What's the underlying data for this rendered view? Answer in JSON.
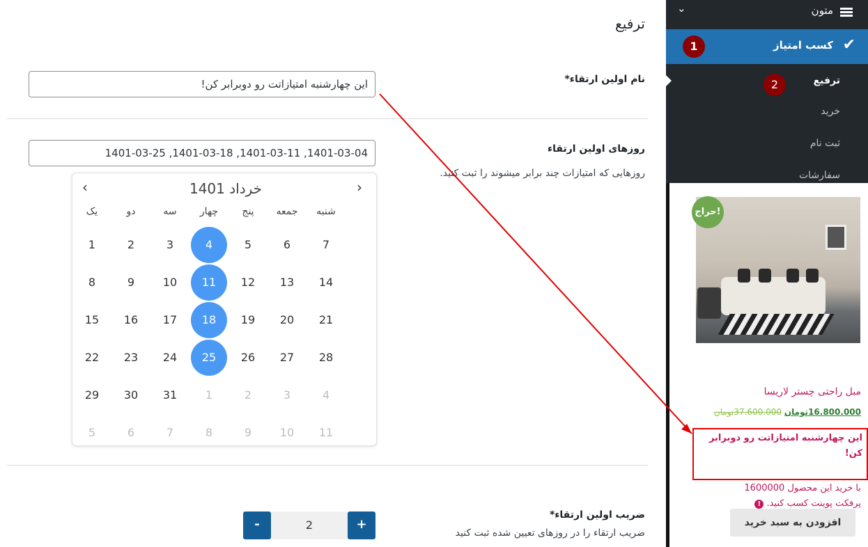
{
  "sidebar": {
    "menu_top": "متون",
    "active_item": "کسب امتیاز",
    "badge1": "1",
    "badge2": "2",
    "submenu": [
      "ترفیع",
      "خرید",
      "ثبت نام",
      "سفارشات"
    ]
  },
  "product": {
    "sale_badge": "حراج!",
    "title": "مبل راحتی چستر لاریسا",
    "price_old": "37.600.000",
    "price_old_currency": "تومان",
    "price_new": "16.800.000",
    "price_new_currency": "تومان",
    "promo_text": "این چهارشنبه امتیازاتت رو دوبرابر کن!",
    "points_line1": "با خرید این محصول 1600000",
    "points_line2": "پرفکت پوینت کسب کنید.",
    "add_to_cart": "افزودن به سبد خرید"
  },
  "form": {
    "page_title": "ترفیع",
    "name_label": "نام اولین ارتقاء*",
    "name_value": "این چهارشنبه امتیازاتت رو دوبرابر کن!",
    "days_label": "روزهای اولین ارتقاء",
    "days_value": "1401-03-04, 1401-03-11, 1401-03-18, 1401-03-25",
    "days_desc": "روزهایی که امتیازات چند برابر میشوند را ثبت کنید.",
    "multiplier_label": "ضریب اولین ارتقاء*",
    "multiplier_desc": "ضریب ارتقاء را در روزهای تعیین شده ثبت کنید",
    "multiplier_value": "2",
    "minus": "-",
    "plus": "+"
  },
  "calendar": {
    "title": "1401 خرداد",
    "prev": "‹",
    "next": "›",
    "weekdays": [
      "یک",
      "دو",
      "سه",
      "چهار",
      "پنج",
      "جمعه",
      "شنبه"
    ],
    "rows": [
      [
        "1",
        "2",
        "3",
        "4",
        "5",
        "6",
        "7"
      ],
      [
        "8",
        "9",
        "10",
        "11",
        "12",
        "13",
        "14"
      ],
      [
        "15",
        "16",
        "17",
        "18",
        "19",
        "20",
        "21"
      ],
      [
        "22",
        "23",
        "24",
        "25",
        "26",
        "27",
        "28"
      ],
      [
        "29",
        "30",
        "31",
        "1",
        "2",
        "3",
        "4"
      ],
      [
        "5",
        "6",
        "7",
        "8",
        "9",
        "10",
        "11"
      ]
    ],
    "selected_days": [
      "4",
      "11",
      "18",
      "25"
    ]
  },
  "colors": {
    "sidebar_bg": "#23282d",
    "active_bg": "#2271b1",
    "selected_day": "#4a9af5",
    "badge": "#8b0000",
    "annotation": "#e00000",
    "stepper": "#135e96"
  }
}
